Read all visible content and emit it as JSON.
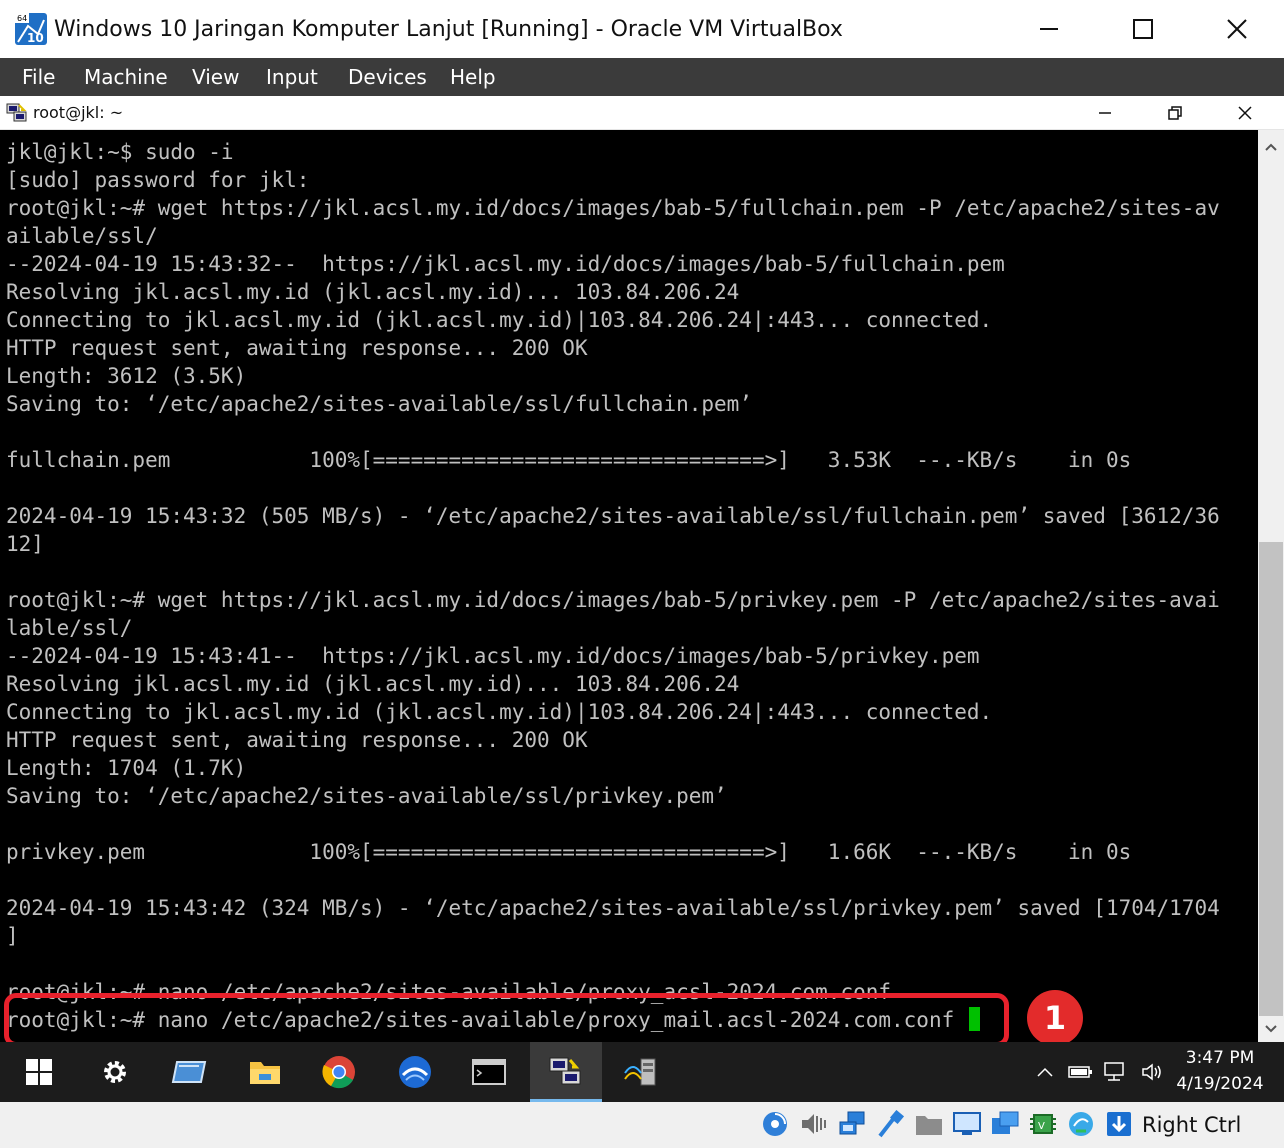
{
  "window": {
    "title": "Windows 10 Jaringan Komputer Lanjut [Running] - Oracle VM VirtualBox",
    "app_icon_text": "10",
    "app_icon_badge": "64"
  },
  "menubar": {
    "items": [
      "File",
      "Machine",
      "View",
      "Input",
      "Devices",
      "Help"
    ]
  },
  "guest_window": {
    "title": "root@jkl: ~"
  },
  "terminal": {
    "lines": [
      "jkl@jkl:~$ sudo -i",
      "[sudo] password for jkl:",
      "root@jkl:~# wget https://jkl.acsl.my.id/docs/images/bab-5/fullchain.pem -P /etc/apache2/sites-av",
      "ailable/ssl/",
      "--2024-04-19 15:43:32--  https://jkl.acsl.my.id/docs/images/bab-5/fullchain.pem",
      "Resolving jkl.acsl.my.id (jkl.acsl.my.id)... 103.84.206.24",
      "Connecting to jkl.acsl.my.id (jkl.acsl.my.id)|103.84.206.24|:443... connected.",
      "HTTP request sent, awaiting response... 200 OK",
      "Length: 3612 (3.5K)",
      "Saving to: ‘/etc/apache2/sites-available/ssl/fullchain.pem’",
      "",
      "fullchain.pem           100%[===============================>]   3.53K  --.-KB/s    in 0s",
      "",
      "2024-04-19 15:43:32 (505 MB/s) - ‘/etc/apache2/sites-available/ssl/fullchain.pem’ saved [3612/36",
      "12]",
      "",
      "root@jkl:~# wget https://jkl.acsl.my.id/docs/images/bab-5/privkey.pem -P /etc/apache2/sites-avai",
      "lable/ssl/",
      "--2024-04-19 15:43:41--  https://jkl.acsl.my.id/docs/images/bab-5/privkey.pem",
      "Resolving jkl.acsl.my.id (jkl.acsl.my.id)... 103.84.206.24",
      "Connecting to jkl.acsl.my.id (jkl.acsl.my.id)|103.84.206.24|:443... connected.",
      "HTTP request sent, awaiting response... 200 OK",
      "Length: 1704 (1.7K)",
      "Saving to: ‘/etc/apache2/sites-available/ssl/privkey.pem’",
      "",
      "privkey.pem             100%[===============================>]   1.66K  --.-KB/s    in 0s",
      "",
      "2024-04-19 15:43:42 (324 MB/s) - ‘/etc/apache2/sites-available/ssl/privkey.pem’ saved [1704/1704",
      "]",
      "",
      "root@jkl:~# nano /etc/apache2/sites-available/proxy_acsl-2024.com.conf",
      "root@jkl:~# nano /etc/apache2/sites-available/proxy_mail.acsl-2024.com.conf "
    ]
  },
  "annotation": {
    "step": "1",
    "color": "#e8212c"
  },
  "taskbar": {
    "items": [
      "start-icon",
      "settings-icon",
      "remote-desktop-icon",
      "file-explorer-icon",
      "chrome-icon",
      "browser-icon",
      "terminal-icon",
      "putty-icon",
      "network-tool-icon"
    ],
    "active_item": "putty-icon",
    "clock_time": "3:47 PM",
    "clock_date": "4/19/2024"
  },
  "statusbar": {
    "host_key": "Right Ctrl"
  }
}
